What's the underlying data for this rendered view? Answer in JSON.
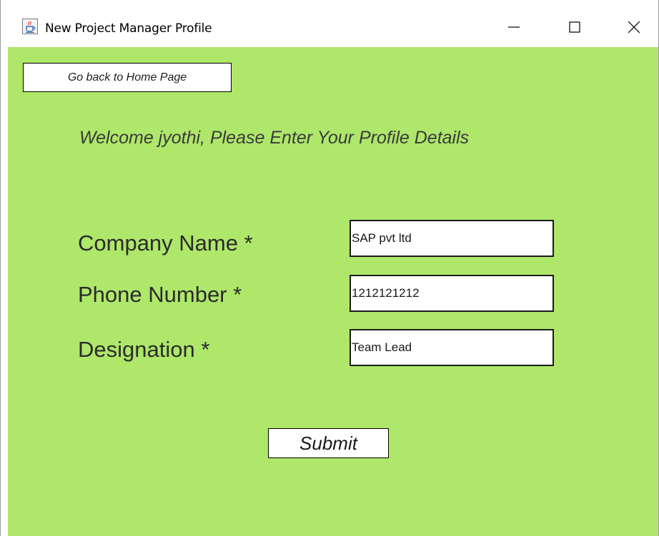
{
  "window": {
    "title": "New Project Manager Profile",
    "icon": "java-cup-icon",
    "controls": [
      "minimize-icon",
      "maximize-icon",
      "close-icon"
    ]
  },
  "nav": {
    "home_button_label": "Go back to Home Page"
  },
  "form": {
    "welcome_text": "Welcome jyothi, Please Enter Your Profile Details",
    "fields": [
      {
        "label": "Company Name *",
        "value": "SAP pvt ltd"
      },
      {
        "label": "Phone Number *",
        "value": "1212121212"
      },
      {
        "label": "Designation *",
        "value": "Team Lead"
      }
    ],
    "submit_label": "Submit"
  },
  "colors": {
    "background": "#aee76a",
    "titlebar": "#ffffff"
  }
}
